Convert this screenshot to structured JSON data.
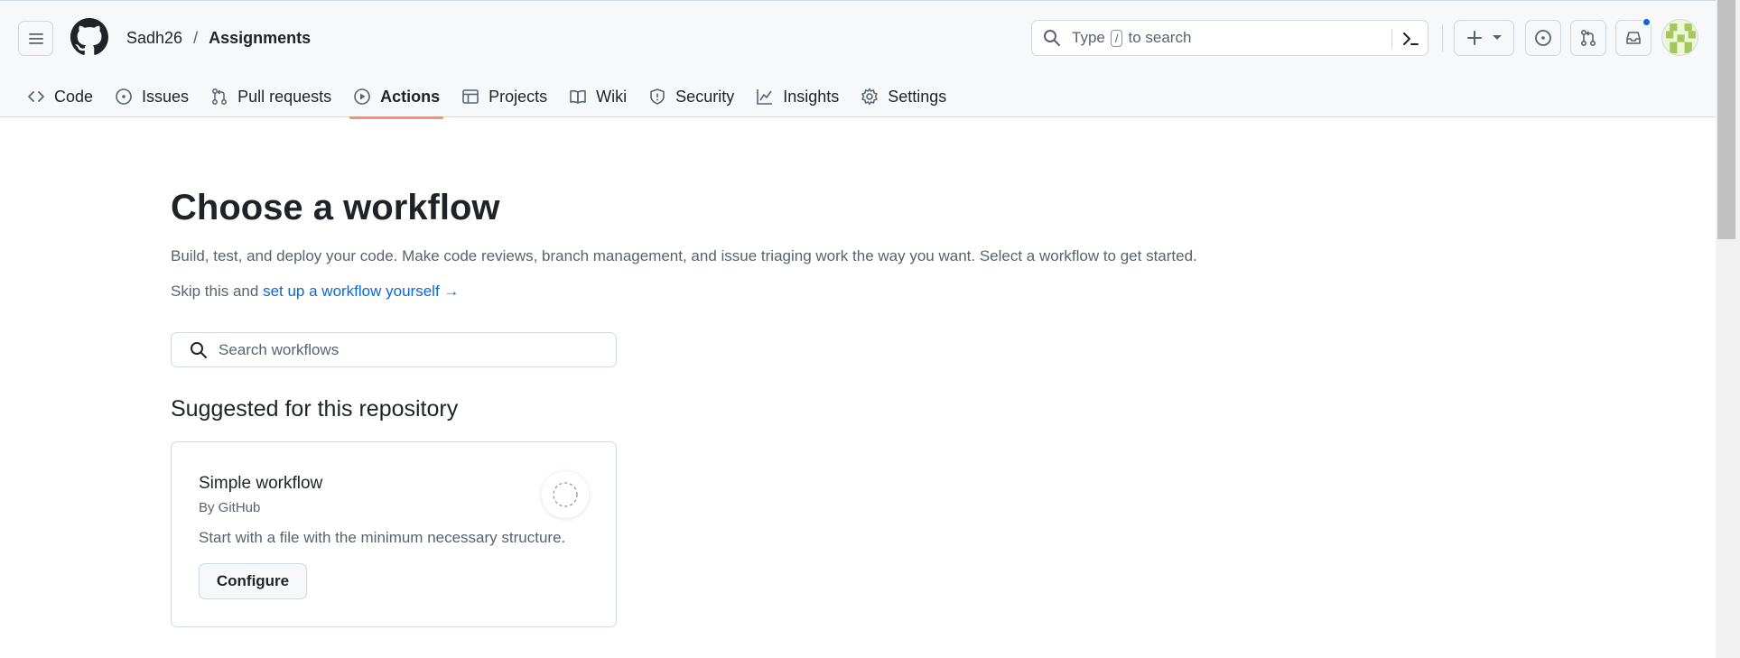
{
  "header": {
    "owner": "Sadh26",
    "separator": "/",
    "repo": "Assignments",
    "search": {
      "prefix": "Type",
      "key": "/",
      "suffix": "to search"
    }
  },
  "tabs": [
    {
      "label": "Code",
      "icon": "code-icon"
    },
    {
      "label": "Issues",
      "icon": "issue-opened-icon"
    },
    {
      "label": "Pull requests",
      "icon": "git-pull-request-icon"
    },
    {
      "label": "Actions",
      "icon": "play-icon",
      "active": true
    },
    {
      "label": "Projects",
      "icon": "table-icon"
    },
    {
      "label": "Wiki",
      "icon": "book-icon"
    },
    {
      "label": "Security",
      "icon": "shield-icon"
    },
    {
      "label": "Insights",
      "icon": "graph-icon"
    },
    {
      "label": "Settings",
      "icon": "gear-icon"
    }
  ],
  "main": {
    "title": "Choose a workflow",
    "description": "Build, test, and deploy your code. Make code reviews, branch management, and issue triaging work the way you want. Select a workflow to get started.",
    "skip_prefix": "Skip this and",
    "skip_link": "set up a workflow yourself",
    "skip_arrow": "→",
    "search_placeholder": "Search workflows",
    "suggested_heading": "Suggested for this repository",
    "card": {
      "name": "Simple workflow",
      "by": "By GitHub",
      "description": "Start with a file with the minimum necessary structure.",
      "button": "Configure"
    }
  },
  "colors": {
    "accent_underline": "#fd8c73",
    "link": "#0969da",
    "notification": "#0969da"
  }
}
